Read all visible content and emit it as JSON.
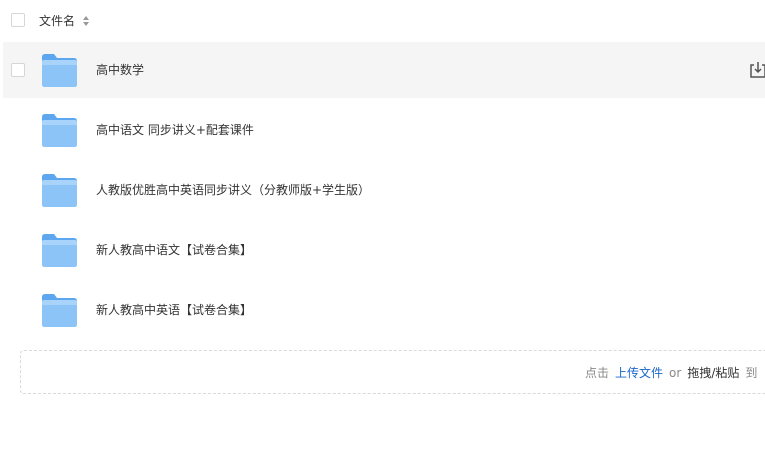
{
  "header": {
    "column_label": "文件名"
  },
  "files": [
    {
      "name": "高中数学",
      "active": true
    },
    {
      "name": "高中语文 同步讲义+配套课件",
      "active": false
    },
    {
      "name": "人教版优胜高中英语同步讲义（分教师版+学生版）",
      "active": false
    },
    {
      "name": "新人教高中语文【试卷合集】",
      "active": false
    },
    {
      "name": "新人教高中英语【试卷合集】",
      "active": false
    }
  ],
  "upload": {
    "prefix": "点击",
    "link": "上传文件",
    "or": "or",
    "action": "拖拽/粘贴",
    "suffix": "到"
  },
  "colors": {
    "folder": "#7ab8f5",
    "link": "#1a66c9",
    "row_hover": "#f5f5f5"
  }
}
